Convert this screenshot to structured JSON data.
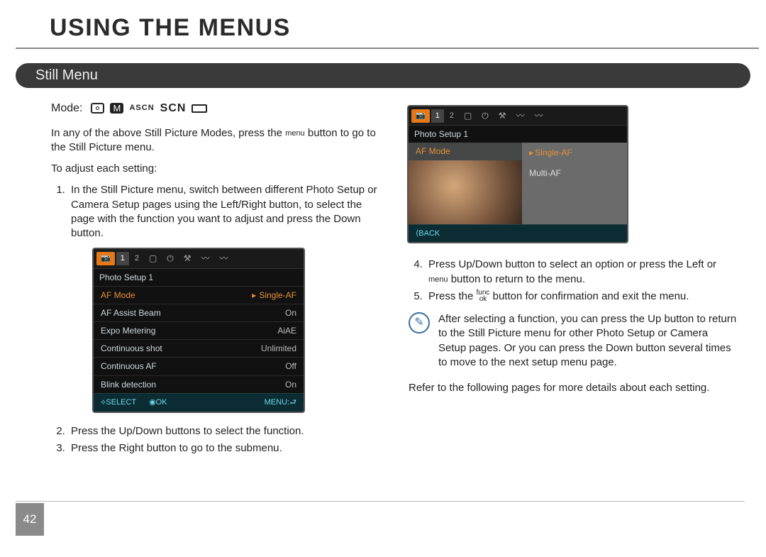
{
  "page": {
    "title": "USING THE MENUS",
    "section": "Still Menu",
    "number": "42"
  },
  "left": {
    "mode_label": "Mode:",
    "mode_icons": {
      "ascn": "ASCN",
      "scn": "SCN",
      "m": "M"
    },
    "intro_a": "In any of the above Still Picture Modes, press the ",
    "intro_menu": "menu",
    "intro_b": " button to go to the Still  Picture menu.",
    "adjust": "To adjust each setting:",
    "step1": "In the Still Picture menu, switch between different Photo Setup or Camera Setup pages using the Left/Right button, to select the page with the function you want to adjust and press the Down button.",
    "step2": "Press the Up/Down buttons to select the function.",
    "step3": "Press the Right button to go to the submenu."
  },
  "right": {
    "step4_a": "Press Up/Down button to select an option or press the Left or ",
    "step4_menu": "menu",
    "step4_b": " button to return to the menu.",
    "step5_a": "Press the ",
    "step5_func": "func",
    "step5_ok": "ok",
    "step5_b": " button for confirmation and exit the menu.",
    "note": "After selecting a function, you can press the Up button to return to the Still Picture menu for other Photo Setup or Camera Setup pages. Or you can press the Down button several times to move to the next setup menu page.",
    "refer": "Refer to the following pages for more details about each setting."
  },
  "screen1": {
    "title": "Photo Setup 1",
    "tabs": {
      "cam": "📷",
      "n1": "1",
      "n2": "2"
    },
    "rows": [
      {
        "k": "AF Mode",
        "v": "Single-AF",
        "hl": true,
        "arrow": true
      },
      {
        "k": "AF Assist Beam",
        "v": "On"
      },
      {
        "k": "Expo Metering",
        "v": "AiAE"
      },
      {
        "k": "Continuous shot",
        "v": "Unlimited"
      },
      {
        "k": "Continuous AF",
        "v": "Off"
      },
      {
        "k": "Blink detection",
        "v": "On"
      }
    ],
    "footer": {
      "select": "⟡SELECT",
      "ok": "◉OK",
      "menu": "MENU:⮐"
    }
  },
  "screen2": {
    "title": "Photo Setup 1",
    "tabs": {
      "cam": "📷",
      "n1": "1",
      "n2": "2"
    },
    "left_label": "AF Mode",
    "opts": [
      {
        "label": "Single-AF",
        "hl": true,
        "arrow": true
      },
      {
        "label": "Multi-AF"
      }
    ],
    "back": "⟨BACK"
  }
}
